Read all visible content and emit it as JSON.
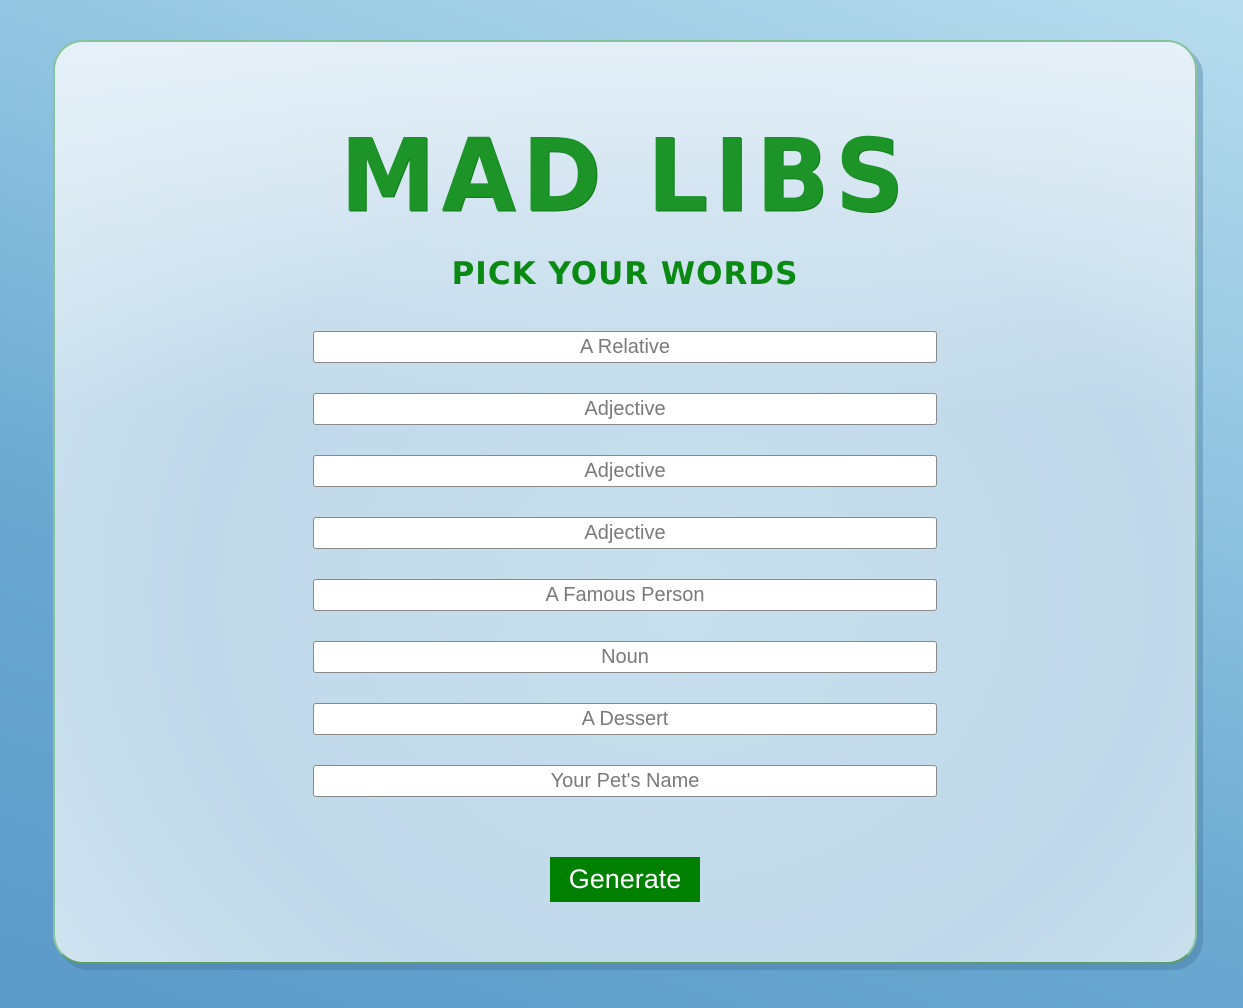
{
  "header": {
    "title": "MAD LIBS",
    "subtitle": "PICK YOUR WORDS"
  },
  "form": {
    "fields": [
      {
        "placeholder": "A Relative",
        "value": ""
      },
      {
        "placeholder": "Adjective",
        "value": ""
      },
      {
        "placeholder": "Adjective",
        "value": ""
      },
      {
        "placeholder": "Adjective",
        "value": ""
      },
      {
        "placeholder": "A Famous Person",
        "value": ""
      },
      {
        "placeholder": "Noun",
        "value": ""
      },
      {
        "placeholder": "A Dessert",
        "value": ""
      },
      {
        "placeholder": "Your Pet's Name",
        "value": ""
      }
    ],
    "generate_label": "Generate"
  },
  "colors": {
    "title": "#1d9428",
    "subtitle": "#0a8a12",
    "button_bg": "#008000",
    "button_text": "#ffffff",
    "card_border": "#86c39a"
  }
}
